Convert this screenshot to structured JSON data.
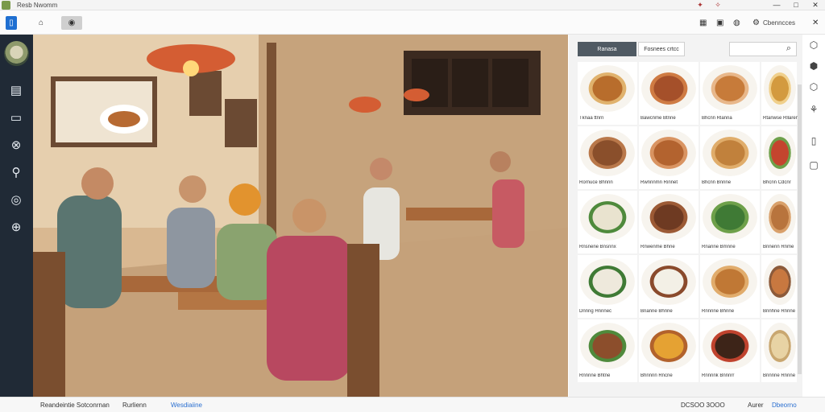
{
  "window": {
    "title": "Resb Nwomm",
    "controls": [
      "—",
      "□",
      "✕"
    ],
    "extra_icons": [
      "✦",
      "✧"
    ]
  },
  "toolbar": {
    "left_icons": [
      "▯",
      "⌂",
      "◉"
    ],
    "right_icons": [
      "▦",
      "▣",
      "◍",
      "⚙"
    ],
    "label": "Cbenncces",
    "close": "✕"
  },
  "sidebar": {
    "icons": [
      "▤",
      "▭",
      "⊗",
      "⚲",
      "◎",
      "⊕"
    ]
  },
  "scene": {
    "description_colors": [
      "#c9a27a",
      "#6b4a33",
      "#e9dcc6"
    ]
  },
  "rpanel": {
    "tabs": {
      "active": "Ranasa",
      "inactive": "Fosnees crtcc"
    },
    "search": {
      "placeholder": "",
      "icon": "⌕"
    },
    "cards": [
      "Tknaa ttnrn",
      "Bawcnme Btnne",
      "Bhcnn Rlanna",
      "Rtanwse Rllaren",
      "Rornuce Bhnnn",
      "Rwnnnmn Rinnet",
      "Bhcnn Bnnne",
      "Bhcnn Cdcnr",
      "Rnsnene Bnsnnx",
      "Rnwenme Bhne",
      "Rnanne Bmnne",
      "Bnnenn Rnme",
      "Dnnng Hnnnec",
      "Bnanne Bhnne",
      "Rnnnne Bhnne",
      "Bnnhne Rnnne",
      "Rnnnne Bhtne",
      "Bhnnnn Rncne",
      "Rnnnnk Bnnnrr",
      "Bnnnne Rnnne"
    ]
  },
  "rail": {
    "icons": [
      "⬡",
      "⬢",
      "⬡",
      "⚘",
      "▯",
      "▢"
    ]
  },
  "status": {
    "left1": "Reandeintie Sotconrnan",
    "left2": "Rurlienn",
    "left3": "Wesdiaiine",
    "right1": "DCSOO 3OOO",
    "right2": "Aurer",
    "right3": "Dbeorno"
  }
}
